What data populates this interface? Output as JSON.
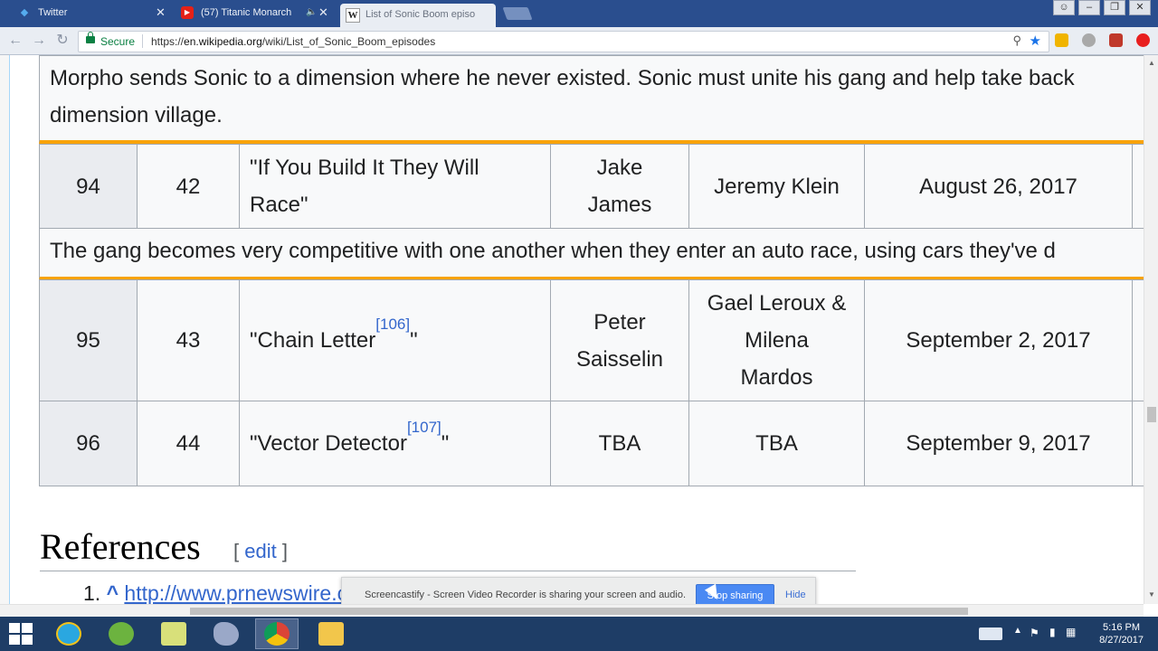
{
  "browser": {
    "tabs": [
      {
        "title": "Twitter",
        "icon": "twitter-icon",
        "active": false
      },
      {
        "title": "(57) Titanic Monarch",
        "icon": "youtube-icon",
        "active": false
      },
      {
        "title": "List of Sonic Boom episo",
        "icon": "wikipedia-icon",
        "active": true
      }
    ],
    "secure_label": "Secure",
    "url_prefix": "https://",
    "url_host": "en.wikipedia.org",
    "url_path": "/wiki/List_of_Sonic_Boom_episodes"
  },
  "table": {
    "summary_top": "Morpho sends Sonic to a dimension where he never existed. Sonic must unite his gang and help take back",
    "summary_top_cont": "dimension village.",
    "rows": [
      {
        "no_overall": "94",
        "no_season": "42",
        "title": "\"If You Build It They Will Race\"",
        "title_line1": "\"If You Build It They Will",
        "title_line2": "Race\"",
        "ref": "",
        "directed_line1": "Jake",
        "directed_line2": "James",
        "written_line1": "Jeremy Klein",
        "air_date": "August 26, 2017",
        "summary": "The gang becomes very competitive with one another when they enter an auto race, using cars they've d"
      },
      {
        "no_overall": "95",
        "no_season": "43",
        "title_before": "\"Chain Letter",
        "ref": "[106]",
        "title_after": "\"",
        "directed_line1": "Peter",
        "directed_line2": "Saisselin",
        "written_line1": "Gael Leroux &",
        "written_line2": "Milena",
        "written_line3": "Mardos",
        "air_date": "September 2, 2017"
      },
      {
        "no_overall": "96",
        "no_season": "44",
        "title_before": "\"Vector Detector",
        "ref": "[107]",
        "title_after": "\"",
        "directed_line1": "TBA",
        "written_line1": "TBA",
        "air_date": "September 9, 2017"
      }
    ]
  },
  "references": {
    "heading": "References",
    "edit_open": "[ ",
    "edit_label": "edit",
    "edit_close": " ]",
    "item1_number": "1.",
    "item1_caret": "^",
    "item1_link": "http://www.prnewswire.co"
  },
  "sharebar": {
    "message": "Screencastify - Screen Video Recorder is sharing your screen and audio.",
    "stop_label": "Stop sharing",
    "hide_label": "Hide"
  },
  "taskbar": {
    "time": "5:16 PM",
    "date": "8/27/2017"
  }
}
